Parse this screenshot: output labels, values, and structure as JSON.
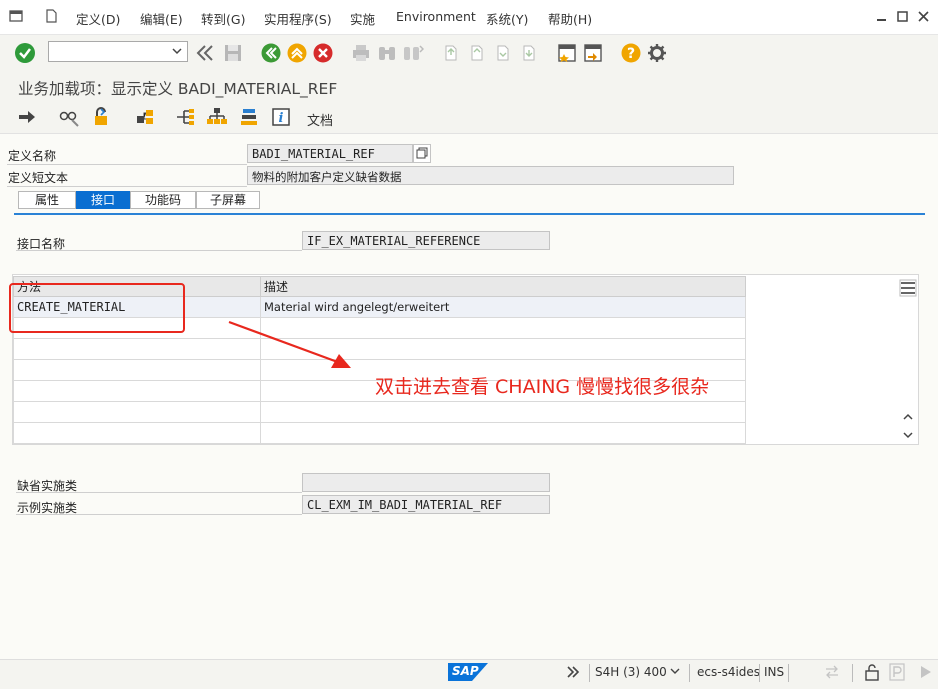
{
  "menubar": {
    "items": [
      "定义(D)",
      "编辑(E)",
      "转到(G)",
      "实用程序(S)",
      "实施",
      "Environment",
      "系统(Y)",
      "帮助(H)"
    ]
  },
  "toolbar": {
    "command_field_value": ""
  },
  "page_title": "业务加载项：显示定义 BADI_MATERIAL_REF",
  "app_toolbar": {
    "docs_label": "文档"
  },
  "definition": {
    "name_label": "定义名称",
    "name_value": "BADI_MATERIAL_REF",
    "short_text_label": "定义短文本",
    "short_text_value": "物料的附加客户定义缺省数据"
  },
  "tabs": [
    {
      "label": "属性",
      "active": false
    },
    {
      "label": "接口",
      "active": true
    },
    {
      "label": "功能码",
      "active": false
    },
    {
      "label": "子屏幕",
      "active": false
    }
  ],
  "interface": {
    "name_label": "接口名称",
    "name_value": "IF_EX_MATERIAL_REFERENCE"
  },
  "methods_table": {
    "columns": [
      "方法",
      "描述"
    ],
    "rows": [
      {
        "method": "CREATE_MATERIAL",
        "description": "Material wird angelegt/erweitert"
      }
    ]
  },
  "annotation": {
    "text": "双击进去查看 CHAING  慢慢找很多很杂",
    "color": "#e8281e"
  },
  "implementation": {
    "default_label": "缺省实施类",
    "default_value": "",
    "example_label": "示例实施类",
    "example_value": "CL_EXM_IM_BADI_MATERIAL_REF"
  },
  "statusbar": {
    "logo_text": "SAP",
    "system": "S4H (3) 400",
    "server": "ecs-s4ides",
    "mode": "INS"
  },
  "colors": {
    "accent": "#0a6ed1",
    "ok_green": "#2e9a3a",
    "nav_green": "#3c9a36",
    "nav_orange": "#f0a500",
    "cancel_red": "#d62b2b",
    "help_yellow": "#f0a500"
  }
}
